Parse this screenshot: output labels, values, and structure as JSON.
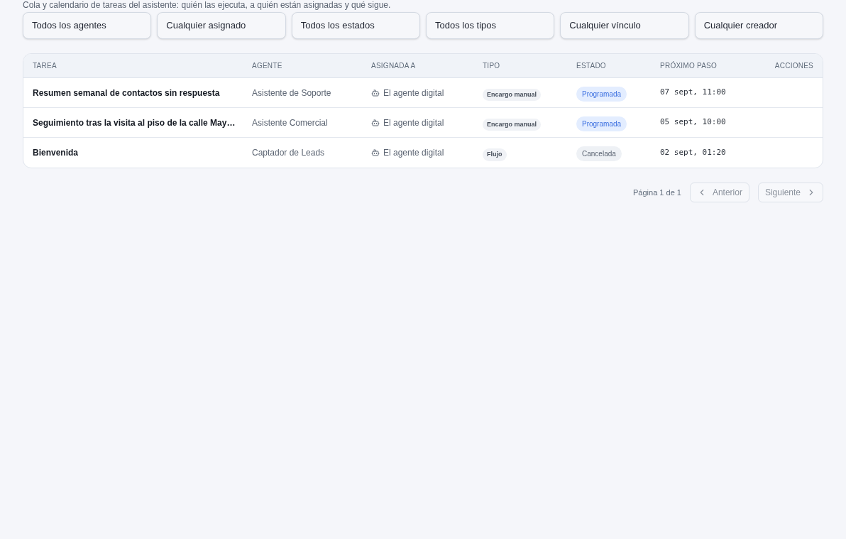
{
  "subtitle": "Cola y calendario de tareas del asistente: quién las ejecuta, a quién están asignadas y qué sigue.",
  "filters": [
    "Todos los agentes",
    "Cualquier asignado",
    "Todos los estados",
    "Todos los tipos",
    "Cualquier vínculo",
    "Cualquier creador"
  ],
  "table": {
    "columns": [
      "TAREA",
      "AGENTE",
      "ASIGNADA A",
      "TIPO",
      "ESTADO",
      "PRÓXIMO PASO",
      "ACCIONES"
    ],
    "rows": [
      {
        "task": "Resumen semanal de contactos sin respuesta",
        "agent": "Asistente de Soporte",
        "assigned": "El agente digital",
        "type": "Encargo manual",
        "status": {
          "label": "Programada",
          "kind": "scheduled"
        },
        "next": "07 sept, 11:00"
      },
      {
        "task": "Seguimiento tras la visita al piso de la calle May…",
        "agent": "Asistente Comercial",
        "assigned": "El agente digital",
        "type": "Encargo manual",
        "status": {
          "label": "Programada",
          "kind": "scheduled"
        },
        "next": "05 sept, 10:00"
      },
      {
        "task": "Bienvenida",
        "agent": "Captador de Leads",
        "assigned": "El agente digital",
        "type": "Flujo",
        "status": {
          "label": "Cancelada",
          "kind": "cancelled"
        },
        "next": "02 sept, 01:20"
      }
    ]
  },
  "pagination": {
    "label": "Página 1 de 1",
    "previous": {
      "label": "Anterior",
      "disabled": true
    },
    "next": {
      "label": "Siguiente",
      "disabled": true
    }
  }
}
